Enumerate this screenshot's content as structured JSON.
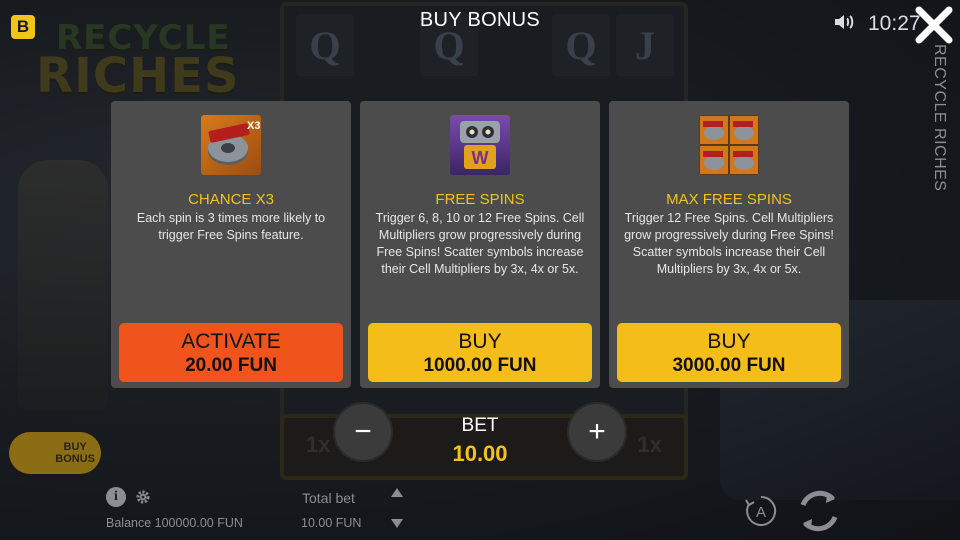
{
  "header": {
    "brand_letter": "B",
    "title": "BUY BONUS",
    "clock": "10:27",
    "game_name": "RECYCLE RICHES"
  },
  "background": {
    "logo_line1": "RECYCLE",
    "logo_line2": "RICHES",
    "reel_symbols": [
      "Q",
      "Q",
      "Q",
      "J",
      "Q",
      "Q"
    ],
    "multipliers": [
      "1x",
      "1x"
    ]
  },
  "cards": [
    {
      "name": "CHANCE X3",
      "description": "Each spin is 3 times more likely to trigger Free Spins feature.",
      "button_label": "ACTIVATE",
      "price": "20.00 FUN",
      "button_color": "#f0531b",
      "icon": "scatter-x3-icon",
      "badge": "X3"
    },
    {
      "name": "FREE SPINS",
      "description": "Trigger 6, 8, 10 or 12 Free Spins. Cell Multipliers grow progressively during Free Spins! Scatter symbols increase their Cell Multipliers by 3x, 4x or 5x.",
      "button_label": "BUY",
      "price": "1000.00 FUN",
      "button_color": "#f4bd1a",
      "icon": "robot-wild-icon",
      "badge": "W"
    },
    {
      "name": "MAX FREE SPINS",
      "description": "Trigger 12 Free Spins. Cell Multipliers grow progressively during Free Spins! Scatter symbols increase their Cell Multipliers by 3x, 4x or 5x.",
      "button_label": "BUY",
      "price": "3000.00 FUN",
      "button_color": "#f4bd1a",
      "icon": "four-scatters-icon"
    }
  ],
  "bet": {
    "label": "BET",
    "value": "10.00",
    "minus": "−",
    "plus": "+"
  },
  "hud": {
    "buy_bonus_line1": "BUY",
    "buy_bonus_line2": "BONUS",
    "info": "i",
    "balance": "Balance 100000.00 FUN",
    "total_bet_label": "Total bet",
    "total_bet_value": "10.00 FUN",
    "autoplay_letter": "A"
  },
  "colors": {
    "accent": "#f4c21b",
    "card_bg": "#4c4c4c",
    "activate": "#f0531b",
    "buy": "#f4bd1a"
  }
}
